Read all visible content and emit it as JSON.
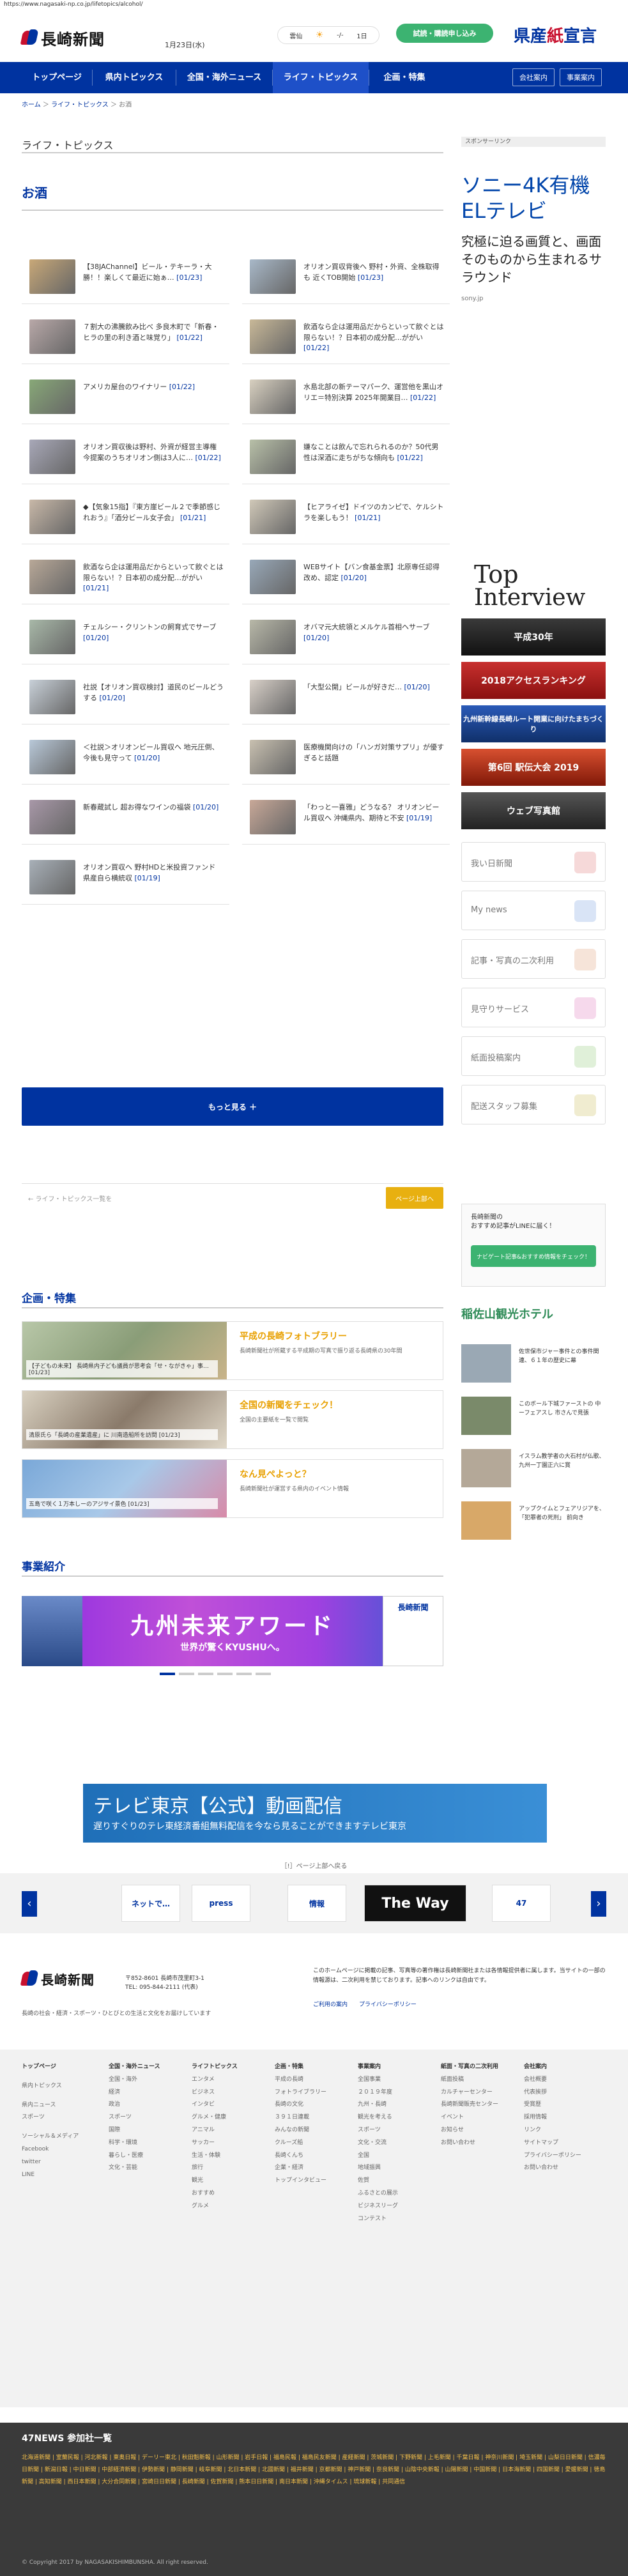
{
  "url": "https://www.nagasaki-np.co.jp/lifetopics/alcohol/",
  "header": {
    "logo": "長崎新聞",
    "date": "1月23日(水)",
    "weather": {
      "place": "雲仙",
      "temp": "-/-",
      "unit": "1日"
    },
    "trial_button": "試読・購読申し込み",
    "banner": {
      "a": "県産",
      "b": "紙",
      "c": "宣言"
    }
  },
  "nav": {
    "items": [
      "トップページ",
      "県内トピックス",
      "全国・海外ニュース",
      "ライフ・トピックス",
      "企画・特集"
    ],
    "buttons": [
      "会社案内",
      "事業案内"
    ]
  },
  "breadcrumb": [
    "ホーム",
    "ライフ・トピックス",
    "お酒"
  ],
  "section_title": "ライフ・トピックス",
  "category_title": "お酒",
  "articles": [
    {
      "title": "【38JAChannel】ビール・テキーラ・大勝！！楽しくて最近に始ぁ…",
      "date": "[01/23]"
    },
    {
      "title": "オリオン買収背後へ 野村・外資、全株取得も 近くTOB開始",
      "date": "[01/23]"
    },
    {
      "title": "７割大の沸騰飲み比べ 多良木町で「新春・ヒラの里の利き酒と味覚り」",
      "date": "[01/22]"
    },
    {
      "title": "飲酒なら企は運用品だからといって飲ぐとは限らない！？日本初の成分配…ががい",
      "date": "[01/22]"
    },
    {
      "title": "アメリカ屋台のワイナリー",
      "date": "[01/22]"
    },
    {
      "title": "水島北部の新テーマパーク、運営他を黒山オリエ＝特別決算 2025年開業目…",
      "date": "[01/22]"
    },
    {
      "title": "オリオン買収後は野村、外資が経営主導権 今提案のうちオリオン側は3人に…",
      "date": "[01/22]"
    },
    {
      "title": "嫌なことは飲んで忘れられるのか？50代男性は深酒に走ちがちな傾向も",
      "date": "[01/22]"
    },
    {
      "title": "◆【気象15指】『東方崖ビール２で季節感じれおう』「酒分ビール女子会」",
      "date": "[01/21]"
    },
    {
      "title": "【ヒアライゼ】ドイツのカンピで、ケルシトラを楽しもう！",
      "date": "[01/21]"
    },
    {
      "title": "飲酒なら企は運用品だからといって飲ぐとは限らない！？日本初の成分配…ががい",
      "date": "[01/21]"
    },
    {
      "title": "WEBサイト【バン食基金票】北原専任認得改め、認定",
      "date": "[01/20]"
    },
    {
      "title": "チェルシー・クリントンの飼育式でサーブ",
      "date": "[01/20]"
    },
    {
      "title": "オバマ元大統領とメルケル首相ヘサーブ",
      "date": "[01/20]"
    },
    {
      "title": "社説【オリオン買収検討】道民のビールどうする",
      "date": "[01/20]"
    },
    {
      "title": "「大型公開」ビールが好きだ…",
      "date": "[01/20]"
    },
    {
      "title": "＜社説＞オリオンビール買収へ 地元圧倒、今後も見守って",
      "date": "[01/20]"
    },
    {
      "title": "医療機関向けの「ハンガ対策サプリ」が優すぎると話題",
      "date": ""
    },
    {
      "title": "新春蔵試し 超お得なワインの福袋",
      "date": "[01/20]"
    },
    {
      "title": "「わっと一喜雅」どうなる？ オリオンビール買収へ 沖縄県内、期待と不安",
      "date": "[01/19]"
    },
    {
      "title": "オリオン買収へ 野村HDと米投資ファンド 県産自ら横統収",
      "date": "[01/19]"
    }
  ],
  "more_button": "もっと見る ＋",
  "prev_link": "← ライフ・トピックス一覧を",
  "next_button": "ページ上部へ",
  "features": {
    "title": "企画・特集",
    "items": [
      {
        "caption": "【子どもの未来】 長崎県内子ども議員が思考会「せ・ながきゃ」事… [01/23]",
        "title": "平成の長崎フォトブラリー",
        "desc": "長崎新聞社が所蔵する平成期の写真で振り返る長崎県の30年間"
      },
      {
        "caption": "清原氏ら「長崎の産業遺産」に 川南造船所を訪問 [01/23]",
        "title": "全国の新聞をチェック！",
        "desc": "全国の主要紙を一覧で閲覧"
      },
      {
        "caption": "五島で咲く１万本しーのアジサイ景色 [01/23]",
        "title": "なん見ぺよっと？",
        "desc": "長崎新聞社が運営する県内のイベント情報"
      }
    ]
  },
  "business": {
    "title": "事業紹介",
    "banner_main": "九州未来アワード",
    "banner_sub": "世界が驚くKYUSHUへ。"
  },
  "tv_ad": {
    "title": "テレビ東京【公式】動画配信",
    "sub": "遅りすぐりのテレ東経済番組無料配信を今なら見ることができますテレビ東京"
  },
  "links_title": "［!］ページ上部へ戻る",
  "carousel": [
    "ネットで…",
    "press",
    "情報",
    "The Way",
    "47"
  ],
  "sidebar": {
    "sponsor": "スポンサーリンク",
    "sony": {
      "headline": "ソニー4K有機ELテレビ",
      "body": "究極に迫る画質と、画面そのものから生まれるサラウンド",
      "url": "sony.jp"
    },
    "top_interview": {
      "a": "Top",
      "b": "Interview"
    },
    "banners": [
      "平成30年",
      "2018アクセスランキング",
      "九州新幹線長崎ルート開業に向けたまちづくり",
      "第6回 駅伝大会 2019",
      "ウェブ写真館"
    ],
    "cards": [
      "我い日新聞",
      "My news",
      "記事・写真の二次利用",
      "見守りサービス",
      "紙面投稿案内",
      "配送スタッフ募集"
    ],
    "line": {
      "text": "長崎新聞の\nおすすめ記事がLINEに届く！",
      "button": "ナビゲート記事&おすすめ情報をチェック！"
    },
    "hotel": "稲佐山観光ホテル",
    "rows": [
      "佐世保市ジャー事件との事件関連、６１年の歴史に幕",
      "このボール下城ファーストの 中ーフェアスし 市さんで見張",
      "イスラム教学者の大石村が仏歌、九州一丁園正六に賞",
      "アップクイムとフェアリジアを、「犯罪者の死刑」 前向き"
    ]
  },
  "footer": {
    "logo": "長崎新聞",
    "address": "〒852-8601 長崎市茂里町3-1\nTEL: 095-844-2111 (代表)",
    "note": "長崎の社会・経済・スポーツ・ひとびとの生活と文化をお届けしています",
    "right": "このホームページに掲載の記事、写真等の著作権は長崎新聞社または各情報提供者に属します。当サイトの一部の情報源は、二次利用を禁じております。記事へのリンクは自由です。",
    "links": [
      "ご利用の案内",
      "プライバシーポリシー"
    ],
    "sitemap": [
      [
        "トップページ",
        "",
        "県内トピックス",
        "",
        "県内ニュース",
        "スポーツ",
        "",
        "ソーシャル＆メディア",
        "Facebook",
        "twitter",
        "LINE"
      ],
      [
        "全国・海外ニュース",
        "全国・海外",
        "経済",
        "政治",
        "スポーツ",
        "国際",
        "科学・環境",
        "暮らし・医療",
        "文化・芸能"
      ],
      [
        "ライフトピックス",
        "エンタメ",
        "ビジネス",
        "インタビ",
        "グルメ・健康",
        "アニマル",
        "サッカー",
        "生活・体験",
        "旅行",
        "観光",
        "おすすめ",
        "グルメ"
      ],
      [
        "企画・特集",
        "平成の長崎",
        "フォトライブラリー",
        "長崎の文化",
        "３９１日連載",
        "みんなの新聞",
        "クルーズ船",
        "長崎くんち",
        "企業・経済",
        "トップインタビュー"
      ],
      [
        "事業案内",
        "全国事業",
        "２０１９年度",
        "九州・長崎",
        "観光を考える",
        "スポーツ",
        "文化・交流",
        "全国",
        "地域振興",
        "佐賀",
        "ふるさとの展示",
        "ビジネスリーグ",
        "コンテスト"
      ],
      [
        "紙面・写真の二次利用",
        "紙面投稿",
        "カルチャーセンター",
        "長崎新聞販売センター",
        "イベント",
        "お知らせ",
        "お問い合わせ"
      ],
      [
        "会社案内",
        "会社概要",
        "代表挨拶",
        "受賞歴",
        "採用情報",
        "リンク",
        "サイトマップ",
        "プライバシーポリシー",
        "お問い合わせ"
      ]
    ],
    "network_title": "47NEWS 参加社一覧",
    "network": "北海道新聞 | 室蘭民報 | 河北新報 | 東奥日報 | デーリー東北 | 秋田魁新報 | 山形新聞 | 岩手日報 | 福島民報 | 福島民友新聞 | 産経新聞 | 茨城新聞 | 下野新聞 | 上毛新聞 | 千葉日報 | 神奈川新聞 | 埼玉新聞 | 山梨日日新聞 | 信濃毎日新聞 | 新潟日報 | 中日新聞 | 中部経済新聞 | 伊勢新聞 | 静岡新聞 | 岐阜新聞 | 北日本新聞 | 北國新聞 | 福井新聞 | 京都新聞 | 神戸新聞 | 奈良新聞 | 山陰中央新報 | 山陽新聞 | 中国新聞 | 日本海新聞 | 四国新聞 | 愛媛新聞 | 徳島新聞 | 高知新聞 | 西日本新聞 | 大分合同新聞 | 宮崎日日新聞 | 長崎新聞 | 佐賀新聞 | 熊本日日新聞 | 南日本新聞 | 沖縄タイムス | 琉球新報 | 共同通信",
    "copyright": "© Copyright 2017 by NAGASAKISHIMBUNSHA. All right reserved."
  },
  "colors": {
    "brand": "#0033a0",
    "accent": "#c8102e",
    "gold": "#e8a000",
    "green": "#3cb371"
  }
}
